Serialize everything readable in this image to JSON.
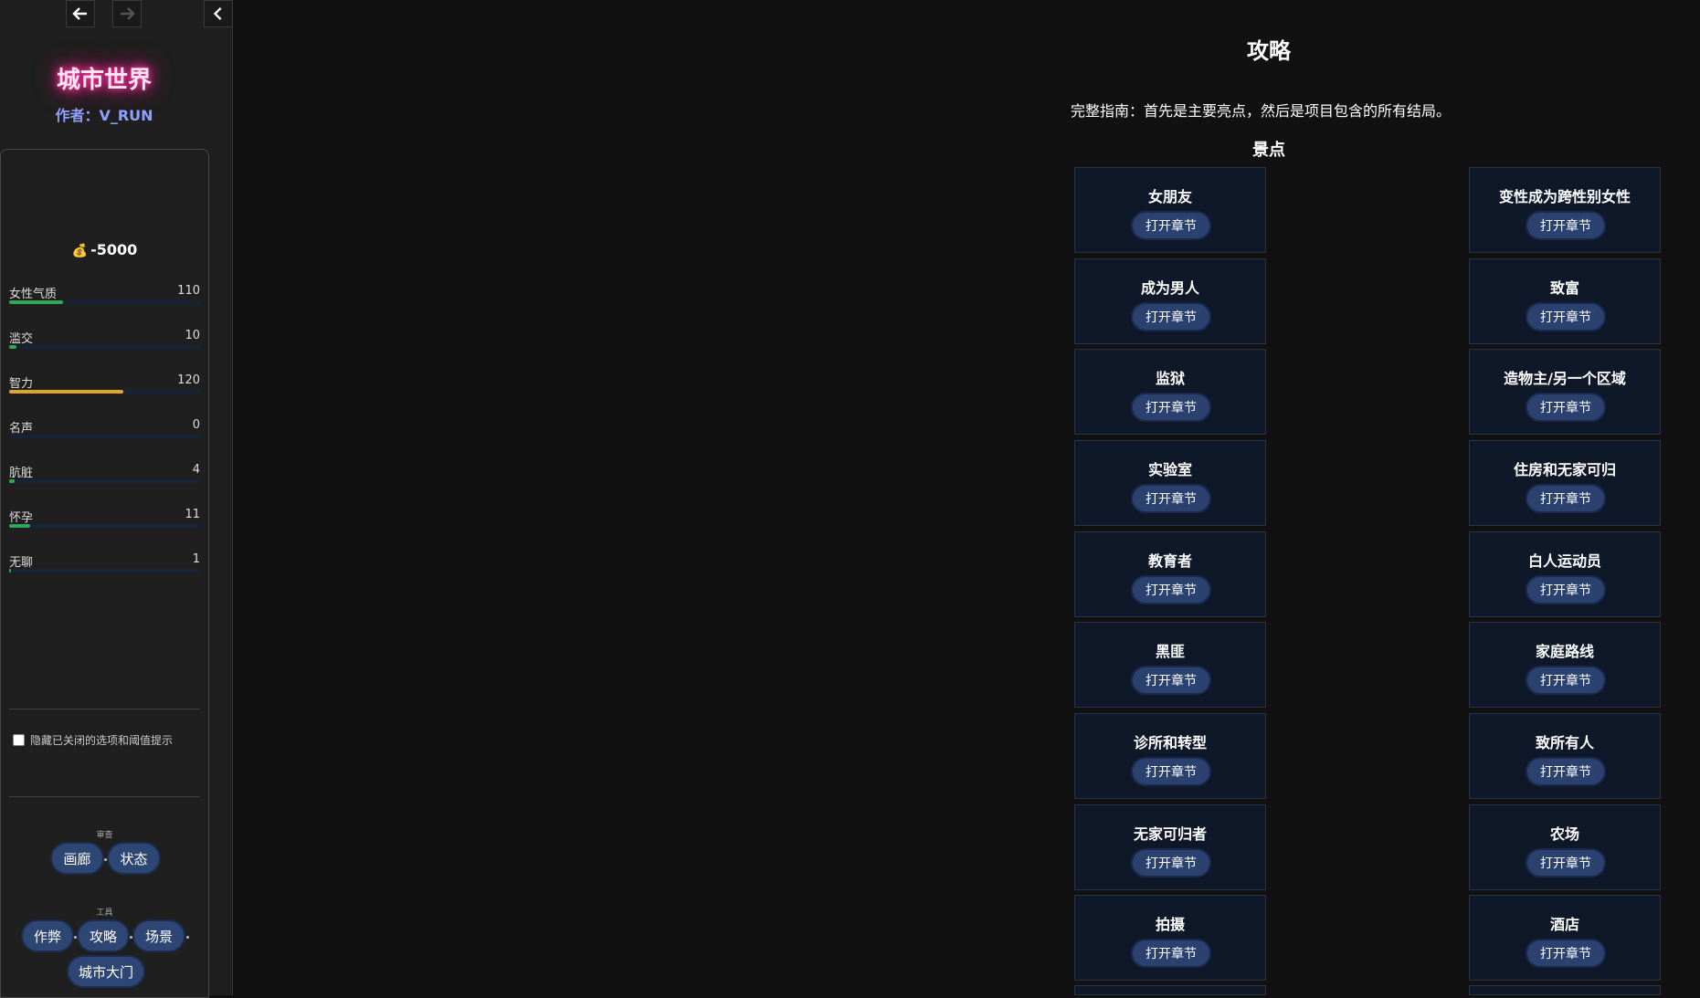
{
  "sidebar": {
    "nav": {
      "back_icon": "arrow-left-icon",
      "forward_icon": "arrow-right-icon",
      "collapse_icon": "chevron-left-icon"
    },
    "title": "城市世界",
    "author": "作者：V_RUN",
    "money": {
      "icon": "money-bag-icon",
      "value": "-5000"
    },
    "stats": [
      {
        "label": "女性气质",
        "value": "110",
        "fill_fraction": 0.28,
        "color": "#2fa85a"
      },
      {
        "label": "滥交",
        "value": "10",
        "fill_fraction": 0.04,
        "color": "#2fa85a"
      },
      {
        "label": "智力",
        "value": "120",
        "fill_fraction": 0.6,
        "color": "#e0a52a"
      },
      {
        "label": "名声",
        "value": "0",
        "fill_fraction": 0.0,
        "color": "#2fa85a"
      },
      {
        "label": "肮脏",
        "value": "4",
        "fill_fraction": 0.03,
        "color": "#2fa85a"
      },
      {
        "label": "怀孕",
        "value": "11",
        "fill_fraction": 0.11,
        "color": "#2fa85a"
      },
      {
        "label": "无聊",
        "value": "1",
        "fill_fraction": 0.01,
        "color": "#2fa85a"
      }
    ],
    "hide_option": "隐藏已关闭的选项和阈值提示",
    "review_group": {
      "label": "审查",
      "buttons": [
        "画廊",
        "状态"
      ]
    },
    "tools_group": {
      "label": "工具",
      "buttons": [
        "作弊",
        "攻略",
        "场景"
      ],
      "last_button": "城市大门"
    }
  },
  "main": {
    "title": "攻略",
    "description": "完整指南：首先是主要亮点，然后是项目包含的所有结局。",
    "section": "景点",
    "open_label": "打开章节",
    "cards_left": [
      "女朋友",
      "成为男人",
      "监狱",
      "实验室",
      "教育者",
      "黑匪",
      "诊所和转型",
      "无家可归者",
      "拍摄"
    ],
    "cards_right": [
      "变性成为跨性别女性",
      "致富",
      "造物主/另一个区域",
      "住房和无家可归",
      "白人运动员",
      "家庭路线",
      "致所有人",
      "农场",
      "酒店"
    ]
  }
}
